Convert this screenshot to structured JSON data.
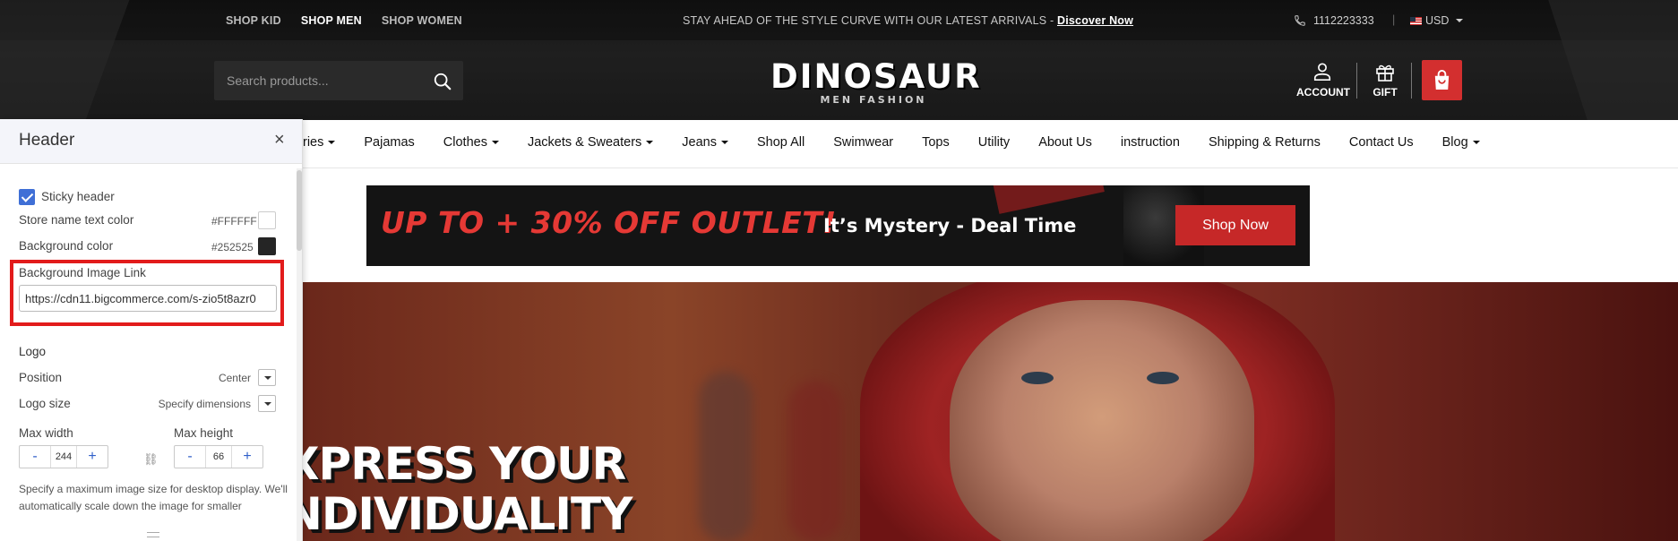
{
  "topbar": {
    "gender_links": [
      "SHOP KID",
      "SHOP MEN",
      "SHOP WOMEN"
    ],
    "promo_text": "STAY AHEAD OF THE STYLE CURVE WITH OUR LATEST ARRIVALS - ",
    "promo_link": "Discover Now",
    "phone": "1112223333",
    "separator": "|",
    "currency": "USD"
  },
  "header": {
    "search_placeholder": "Search products...",
    "logo_name": "DINOSAUR",
    "logo_tagline": "MEN FASHION",
    "account_label": "ACCOUNT",
    "gift_label": "GIFT"
  },
  "nav": {
    "items": [
      {
        "label": "ries",
        "dropdown": true
      },
      {
        "label": "Pajamas",
        "dropdown": false
      },
      {
        "label": "Clothes",
        "dropdown": true
      },
      {
        "label": "Jackets & Sweaters",
        "dropdown": true
      },
      {
        "label": "Jeans",
        "dropdown": true
      },
      {
        "label": "Shop All",
        "dropdown": false
      },
      {
        "label": "Swimwear",
        "dropdown": false
      },
      {
        "label": "Tops",
        "dropdown": false
      },
      {
        "label": "Utility",
        "dropdown": false
      },
      {
        "label": "About Us",
        "dropdown": false
      },
      {
        "label": "instruction",
        "dropdown": false
      },
      {
        "label": "Shipping & Returns",
        "dropdown": false
      },
      {
        "label": "Contact Us",
        "dropdown": false
      },
      {
        "label": "Blog",
        "dropdown": true
      }
    ]
  },
  "banner": {
    "headline": "UP TO + 30% OFF OUTLET!",
    "subtext": "It’s Mystery - Deal Time",
    "button": "Shop Now"
  },
  "hero": {
    "line1": "XPRESS YOUR",
    "line2": "NDIVIDUALITY"
  },
  "panel": {
    "title": "Header",
    "close": "×",
    "sticky_label": "Sticky header",
    "sticky_checked": true,
    "store_name_color_label": "Store name text color",
    "store_name_color_value": "#FFFFFF",
    "bg_color_label": "Background color",
    "bg_color_value": "#252525",
    "bg_image_label": "Background Image Link",
    "bg_image_value": "https://cdn11.bigcommerce.com/s-zio5t8azr0",
    "logo_section": "Logo",
    "position_label": "Position",
    "position_value": "Center",
    "logo_size_label": "Logo size",
    "logo_size_value": "Specify dimensions",
    "max_width_label": "Max width",
    "max_width_value": "244",
    "max_height_label": "Max height",
    "max_height_value": "66",
    "minus": "-",
    "plus": "+",
    "note": "Specify a maximum image size for desktop display. We'll automatically scale down the image for smaller"
  },
  "colors": {
    "accent_red": "#d32f2f",
    "header_dark": "#1f1f1f",
    "checkbox_blue": "#3f6fd6",
    "highlight_red": "#e21b1b"
  }
}
